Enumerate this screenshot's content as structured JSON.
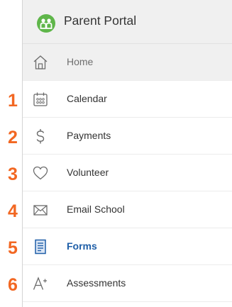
{
  "header": {
    "title": "Parent Portal",
    "logo_icon": "family-logo-icon"
  },
  "callouts": {
    "color": "#f26722",
    "numbers": [
      "1",
      "2",
      "3",
      "4",
      "5",
      "6"
    ]
  },
  "nav": {
    "active_color": "#1f5fa8",
    "items": [
      {
        "label": "Home",
        "icon": "home-icon",
        "state": "highlighted"
      },
      {
        "label": "Calendar",
        "icon": "calendar-icon"
      },
      {
        "label": "Payments",
        "icon": "dollar-icon"
      },
      {
        "label": "Volunteer",
        "icon": "heart-icon"
      },
      {
        "label": "Email School",
        "icon": "envelope-icon"
      },
      {
        "label": "Forms",
        "icon": "form-icon",
        "state": "active"
      },
      {
        "label": "Assessments",
        "icon": "assessment-icon"
      }
    ]
  }
}
